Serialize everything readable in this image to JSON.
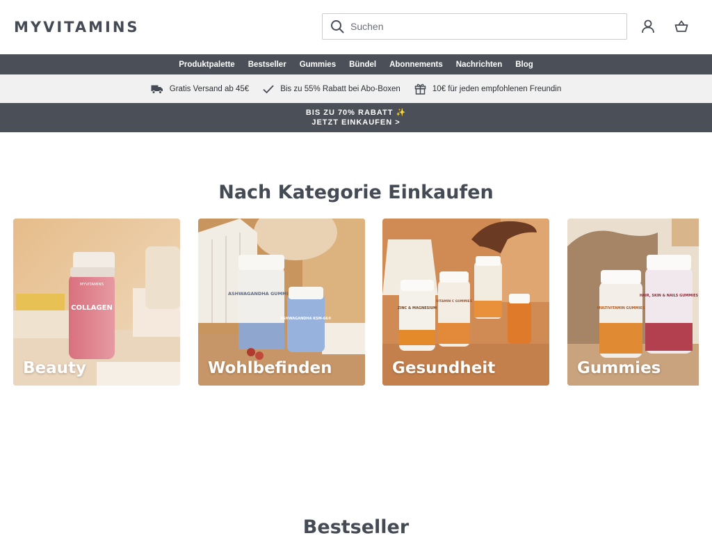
{
  "header": {
    "logo": "MYVITAMINS",
    "search_placeholder": "Suchen"
  },
  "nav": {
    "items": [
      "Produktpalette",
      "Bestseller",
      "Gummies",
      "Bündel",
      "Abonnements",
      "Nachrichten",
      "Blog"
    ]
  },
  "benefits": [
    {
      "icon": "truck-icon",
      "text": "Gratis Versand ab 45€"
    },
    {
      "icon": "check-icon",
      "text": "Bis zu 55% Rabatt bei Abo-Boxen"
    },
    {
      "icon": "gift-icon",
      "text": "10€ für jeden empfohlenen Freundin"
    }
  ],
  "promo": {
    "line1": "BIS ZU 70% RABATT ✨",
    "line2": "JETZT EINKAUFEN >"
  },
  "categories": {
    "title": "Nach Kategorie Einkaufen",
    "items": [
      {
        "label": "Beauty",
        "product_text": "COLLAGEN",
        "brand": "MYVITAMINS"
      },
      {
        "label": "Wohlbefinden",
        "product_text": "ASHWAGANDHA GUMMIES",
        "product_text_2": "ASHWAGANDHA KSM-66®"
      },
      {
        "label": "Gesundheit",
        "product_text": "ZINC & MAGNESIUM",
        "product_text_2": "VITAMIN C GUMMIES"
      },
      {
        "label": "Gummies",
        "product_text": "MULTIVITAMIN GUMMIES",
        "product_text_2": "HAIR, SKIN & NAILS GUMMIES"
      }
    ]
  },
  "bestseller": {
    "title": "Bestseller"
  },
  "colors": {
    "nav_bg": "#4b5058",
    "benefits_bg": "#f1f1f1",
    "text": "#454b54"
  }
}
